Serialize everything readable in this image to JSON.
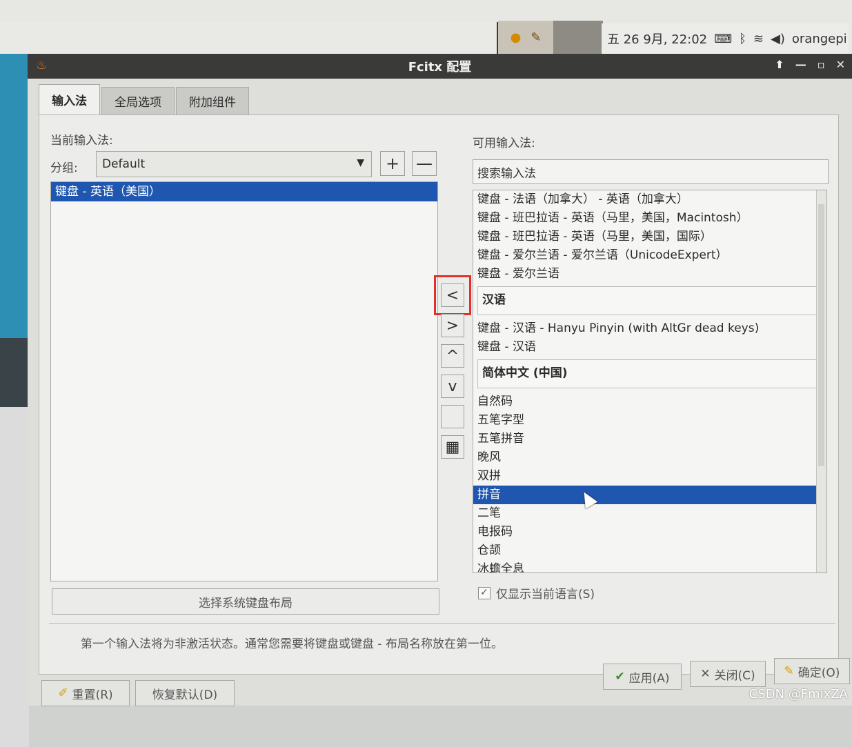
{
  "taskbar": {
    "clock": "五 26 9月, 22:02",
    "user": "orangepi"
  },
  "window": {
    "title": "Fcitx 配置"
  },
  "tabs": [
    {
      "label": "输入法"
    },
    {
      "label": "全局选项"
    },
    {
      "label": "附加组件"
    }
  ],
  "left": {
    "current_label": "当前输入法:",
    "group_label": "分组:",
    "group_value": "Default",
    "add_symbol": "+",
    "remove_symbol": "—",
    "current_items": [
      "键盘 - 英语（美国）"
    ],
    "kbd_layout_button": "选择系统键盘布局"
  },
  "middle": {
    "left_arrow": "<",
    "right_arrow": ">",
    "up_arrow": "^",
    "down_arrow": "v",
    "keyboard_icon": "▦"
  },
  "right": {
    "available_label": "可用输入法:",
    "search_placeholder": "搜索输入法",
    "rows_top": [
      "键盘 - 法语（加拿大） - 英语（加拿大）",
      "键盘 - 班巴拉语 - 英语（马里，美国，Macintosh）",
      "键盘 - 班巴拉语 - 英语（马里，美国，国际）",
      "键盘 - 爱尔兰语 - 爱尔兰语（UnicodeExpert）",
      "键盘 - 爱尔兰语"
    ],
    "group_chinese": "汉语",
    "rows_chinese": [
      "键盘 - 汉语 - Hanyu Pinyin (with AltGr dead keys)",
      "键盘 - 汉语"
    ],
    "group_simplified": "简体中文 (中国)",
    "rows_simplified": [
      "自然码",
      "五笔字型",
      "五笔拼音",
      "晚风",
      "双拼",
      "拼音",
      "二笔",
      "电报码",
      "仓颉",
      "冰蟾全息"
    ],
    "selected": "拼音",
    "only_current_lang": "仅显示当前语言(S)",
    "only_current_lang_checked": true
  },
  "hint": "第一个输入法将为非激活状态。通常您需要将键盘或键盘 - 布局名称放在第一位。",
  "footer": {
    "reset": "重置(R)",
    "restore_default": "恢复默认(D)",
    "apply": "应用(A)",
    "close": "关闭(C)",
    "ok": "确定(O)"
  },
  "watermark": "CSDN @FmixZA"
}
